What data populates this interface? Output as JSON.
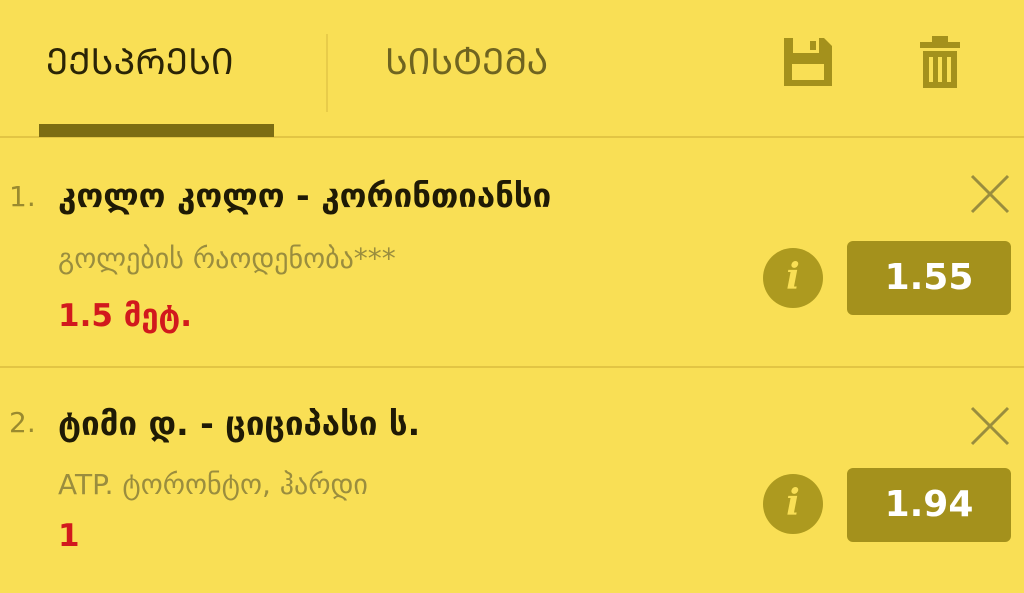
{
  "header": {
    "tabs": [
      {
        "label": "ᲔᲥᲡᲞᲠᲔᲡᲘ",
        "active": true
      },
      {
        "label": "ᲡᲘᲡᲢᲔᲛᲐ",
        "active": false
      }
    ],
    "icons": [
      "save-icon",
      "trash-icon"
    ]
  },
  "bets": [
    {
      "number": "1.",
      "title": "კოლო კოლო - კორინთიანსი",
      "market": "გოლების რაოდენობა***",
      "pick": "1.5 მეტ.",
      "odds": "1.55",
      "info_icon": "i"
    },
    {
      "number": "2.",
      "title": "ტიმი დ. - ციციპასი ს.",
      "market": "ATP. ტორონტო, ჰარდი",
      "pick": "1",
      "odds": "1.94",
      "info_icon": "i"
    }
  ],
  "colors": {
    "background": "#f9df55",
    "accent": "#7c6d13",
    "odds_button": "#a4911c",
    "pick_text": "#d1191d"
  }
}
